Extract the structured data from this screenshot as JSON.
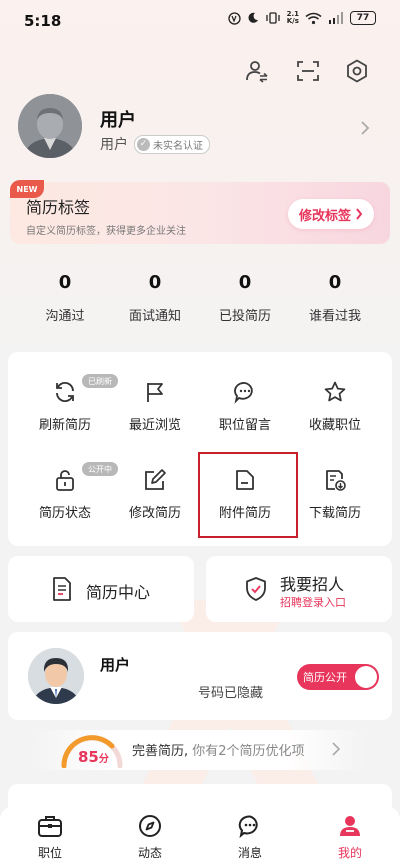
{
  "status_bar": {
    "time": "5:18",
    "net_speed_top": "2.1",
    "net_speed_bottom": "K/s",
    "battery": "77"
  },
  "user": {
    "name": "用户",
    "sub": "用户",
    "verify_label": "未实名认证"
  },
  "tag_banner": {
    "badge": "NEW",
    "title": "简历标签",
    "desc": "自定义简历标签，获得更多企业关注",
    "button": "修改标签"
  },
  "stats": [
    {
      "value": "0",
      "label": "沟通过"
    },
    {
      "value": "0",
      "label": "面试通知"
    },
    {
      "value": "0",
      "label": "已投简历"
    },
    {
      "value": "0",
      "label": "谁看过我"
    }
  ],
  "grid": {
    "refresh_badge": "已刷新",
    "public_badge": "公开中",
    "items": [
      {
        "label": "刷新简历",
        "icon": "refresh-icon"
      },
      {
        "label": "最近浏览",
        "icon": "flag-icon"
      },
      {
        "label": "职位留言",
        "icon": "message-icon"
      },
      {
        "label": "收藏职位",
        "icon": "star-icon"
      },
      {
        "label": "简历状态",
        "icon": "lock-icon"
      },
      {
        "label": "修改简历",
        "icon": "edit-icon"
      },
      {
        "label": "附件简历",
        "icon": "folder-icon"
      },
      {
        "label": "下载简历",
        "icon": "download-doc-icon"
      }
    ]
  },
  "resume_center": {
    "title": "简历中心"
  },
  "recruit": {
    "title": "我要招人",
    "sub": "招聘登录入口"
  },
  "profile_card": {
    "name": "用户",
    "phone": "号码已隐藏",
    "toggle_label": "简历公开"
  },
  "score": {
    "value": "85",
    "unit": "分",
    "text_main": "完善简历,",
    "text_detail": "你有2个简历优化项"
  },
  "bottom_nav": [
    {
      "label": "职位",
      "icon": "briefcase-icon"
    },
    {
      "label": "动态",
      "icon": "compass-icon"
    },
    {
      "label": "消息",
      "icon": "chat-icon"
    },
    {
      "label": "我的",
      "icon": "person-icon"
    }
  ],
  "colors": {
    "accent": "#e7355b",
    "highlight": "#c8202a"
  }
}
